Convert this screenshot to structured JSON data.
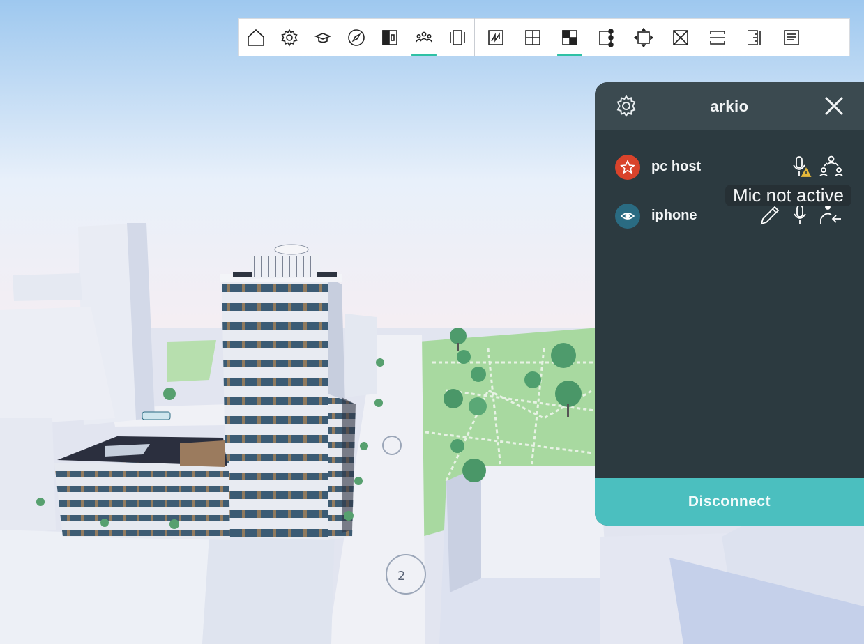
{
  "toolbar": {
    "groups": [
      [
        {
          "icon": "home-icon",
          "active": false
        },
        {
          "icon": "gear-icon",
          "active": false
        },
        {
          "icon": "graduation-cap-icon",
          "active": false
        },
        {
          "icon": "compass-icon",
          "active": false
        },
        {
          "icon": "split-view-icon",
          "active": false
        }
      ],
      [
        {
          "icon": "collaborate-icon",
          "active": true
        },
        {
          "icon": "frame-icon",
          "active": false
        }
      ],
      [
        {
          "icon": "sketch-icon",
          "active": false
        },
        {
          "icon": "grid-icon",
          "active": false
        },
        {
          "icon": "material-icon",
          "active": true
        },
        {
          "icon": "node-edit-icon",
          "active": false
        },
        {
          "icon": "transform-icon",
          "active": false
        },
        {
          "icon": "delete-box-icon",
          "active": false
        },
        {
          "icon": "section-icon",
          "active": false
        },
        {
          "icon": "measure-icon",
          "active": false
        },
        {
          "icon": "document-icon",
          "active": false
        }
      ]
    ],
    "accent": "#2fc1a5"
  },
  "session_panel": {
    "title": "arkio",
    "users": [
      {
        "name": "pc host",
        "role": "host",
        "avatar_icon": "star-icon",
        "avatar_color": "#d9432b"
      },
      {
        "name": "iphone",
        "role": "viewer",
        "avatar_icon": "eye-icon",
        "avatar_color": "#2a6b82"
      }
    ],
    "tooltip": "Mic not active",
    "disconnect_label": "Disconnect",
    "accent": "#4bbfbf"
  }
}
